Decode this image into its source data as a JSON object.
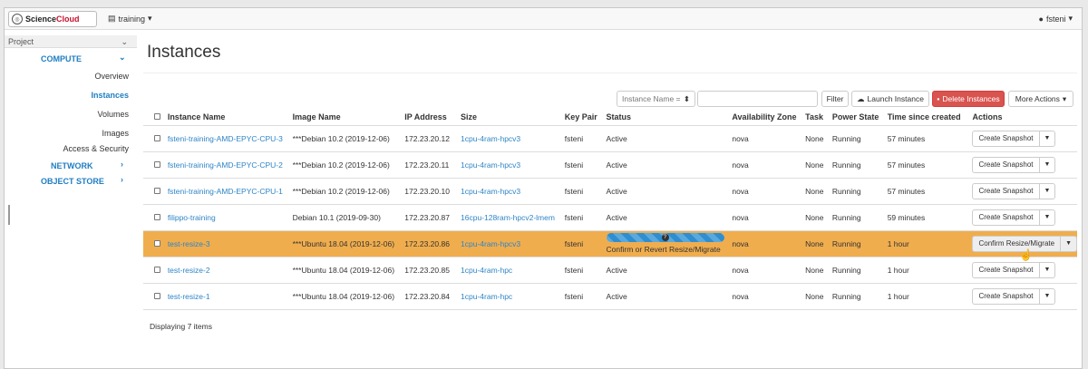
{
  "topbar": {
    "logo_text_1": "Science",
    "logo_text_2": "Cloud",
    "project_label": "training",
    "user_label": "fsteni"
  },
  "sidebar": {
    "project": "Project",
    "compute": "COMPUTE",
    "items": [
      "Overview",
      "Instances",
      "Volumes",
      "Images",
      "Access & Security"
    ],
    "network": "NETWORK",
    "object_store": "OBJECT STORE"
  },
  "page": {
    "title": "Instances"
  },
  "toolbar": {
    "filter_select": "Instance Name =",
    "filter_button": "Filter",
    "launch": "Launch Instance",
    "delete": "Delete Instances",
    "more": "More Actions"
  },
  "table": {
    "headers": [
      "Instance Name",
      "Image Name",
      "IP Address",
      "Size",
      "Key Pair",
      "Status",
      "Availability Zone",
      "Task",
      "Power State",
      "Time since created",
      "Actions"
    ],
    "rows": [
      {
        "name": "fsteni-training-AMD-EPYC-CPU-3",
        "image": "***Debian 10.2 (2019-12-06)",
        "ip": "172.23.20.12",
        "size": "1cpu-4ram-hpcv3",
        "key": "fsteni",
        "status": "Active",
        "zone": "nova",
        "task": "None",
        "power": "Running",
        "time": "57 minutes",
        "action": "Create Snapshot"
      },
      {
        "name": "fsteni-training-AMD-EPYC-CPU-2",
        "image": "***Debian 10.2 (2019-12-06)",
        "ip": "172.23.20.11",
        "size": "1cpu-4ram-hpcv3",
        "key": "fsteni",
        "status": "Active",
        "zone": "nova",
        "task": "None",
        "power": "Running",
        "time": "57 minutes",
        "action": "Create Snapshot"
      },
      {
        "name": "fsteni-training-AMD-EPYC-CPU-1",
        "image": "***Debian 10.2 (2019-12-06)",
        "ip": "172.23.20.10",
        "size": "1cpu-4ram-hpcv3",
        "key": "fsteni",
        "status": "Active",
        "zone": "nova",
        "task": "None",
        "power": "Running",
        "time": "57 minutes",
        "action": "Create Snapshot"
      },
      {
        "name": "filippo-training",
        "image": "Debian 10.1 (2019-09-30)",
        "ip": "172.23.20.87",
        "size": "16cpu-128ram-hpcv2-lmem",
        "key": "fsteni",
        "status": "Active",
        "zone": "nova",
        "task": "None",
        "power": "Running",
        "time": "59 minutes",
        "action": "Create Snapshot"
      },
      {
        "name": "test-resize-3",
        "image": "***Ubuntu 18.04 (2019-12-06)",
        "ip": "172.23.20.86",
        "size": "1cpu-4ram-hpcv3",
        "key": "fsteni",
        "status": "Confirm or Revert Resize/Migrate",
        "zone": "nova",
        "task": "None",
        "power": "Running",
        "time": "1 hour",
        "action": "Confirm Resize/Migrate"
      },
      {
        "name": "test-resize-2",
        "image": "***Ubuntu 18.04 (2019-12-06)",
        "ip": "172.23.20.85",
        "size": "1cpu-4ram-hpc",
        "key": "fsteni",
        "status": "Active",
        "zone": "nova",
        "task": "None",
        "power": "Running",
        "time": "1 hour",
        "action": "Create Snapshot"
      },
      {
        "name": "test-resize-1",
        "image": "***Ubuntu 18.04 (2019-12-06)",
        "ip": "172.23.20.84",
        "size": "1cpu-4ram-hpc",
        "key": "fsteni",
        "status": "Active",
        "zone": "nova",
        "task": "None",
        "power": "Running",
        "time": "1 hour",
        "action": "Create Snapshot"
      }
    ]
  },
  "footer": {
    "count": "Displaying 7 items"
  },
  "colors": {
    "link": "#2e85c7",
    "highlight_row": "#f0ad4e",
    "danger": "#d9534f",
    "progress": "#2f8ed0"
  },
  "icons": {
    "project": "server-icon",
    "user": "user-icon",
    "launch": "cloud-upload-icon",
    "delete": "trash-icon"
  }
}
